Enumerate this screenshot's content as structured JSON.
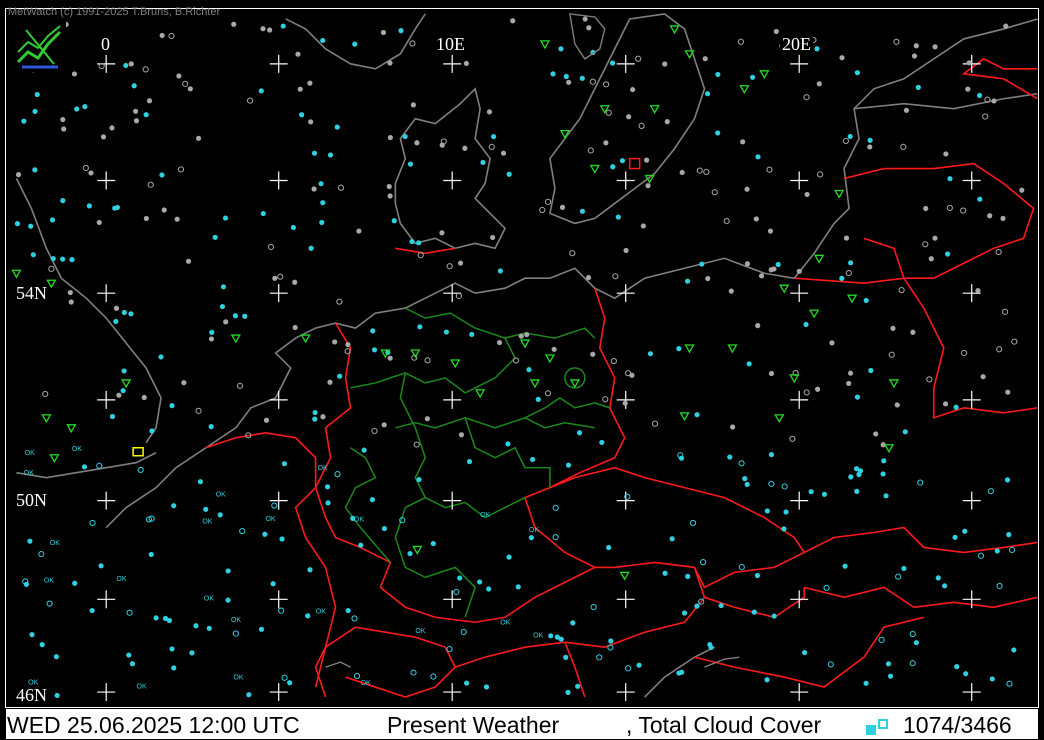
{
  "app": {
    "copyright": "MetWatch  (c) 1991-2025 T.Bruns, B.Richter"
  },
  "grid_labels": {
    "lon_0": "0",
    "lon_10": "10E",
    "lon_20": "20E",
    "lat_54": "54N",
    "lat_50": "50N",
    "lat_46": "46N"
  },
  "status_bar": {
    "datetime": "WED 25.06.2025 12:00 UTC",
    "product": "Present Weather",
    "overlay": ", Total Cloud Cover",
    "station_count": "1074/3466"
  },
  "station_label_ok": "OK",
  "colors": {
    "background": "#000000",
    "coastline": "#808080",
    "country_border": "#ff1a1a",
    "state_border": "#1a8a1a",
    "grid_cross": "#ffffff",
    "station_cloud": "#2fd0e0",
    "station_gray": "#a8a8a8",
    "weather_symbol": "#22dd22",
    "weather_highlight": "#ffff00",
    "status_bg": "#ffffff"
  },
  "icons": {
    "logo": "metwatch-logo-icon",
    "station": "cloud-cover-circle-icon",
    "weather": "present-weather-symbol-icon"
  }
}
